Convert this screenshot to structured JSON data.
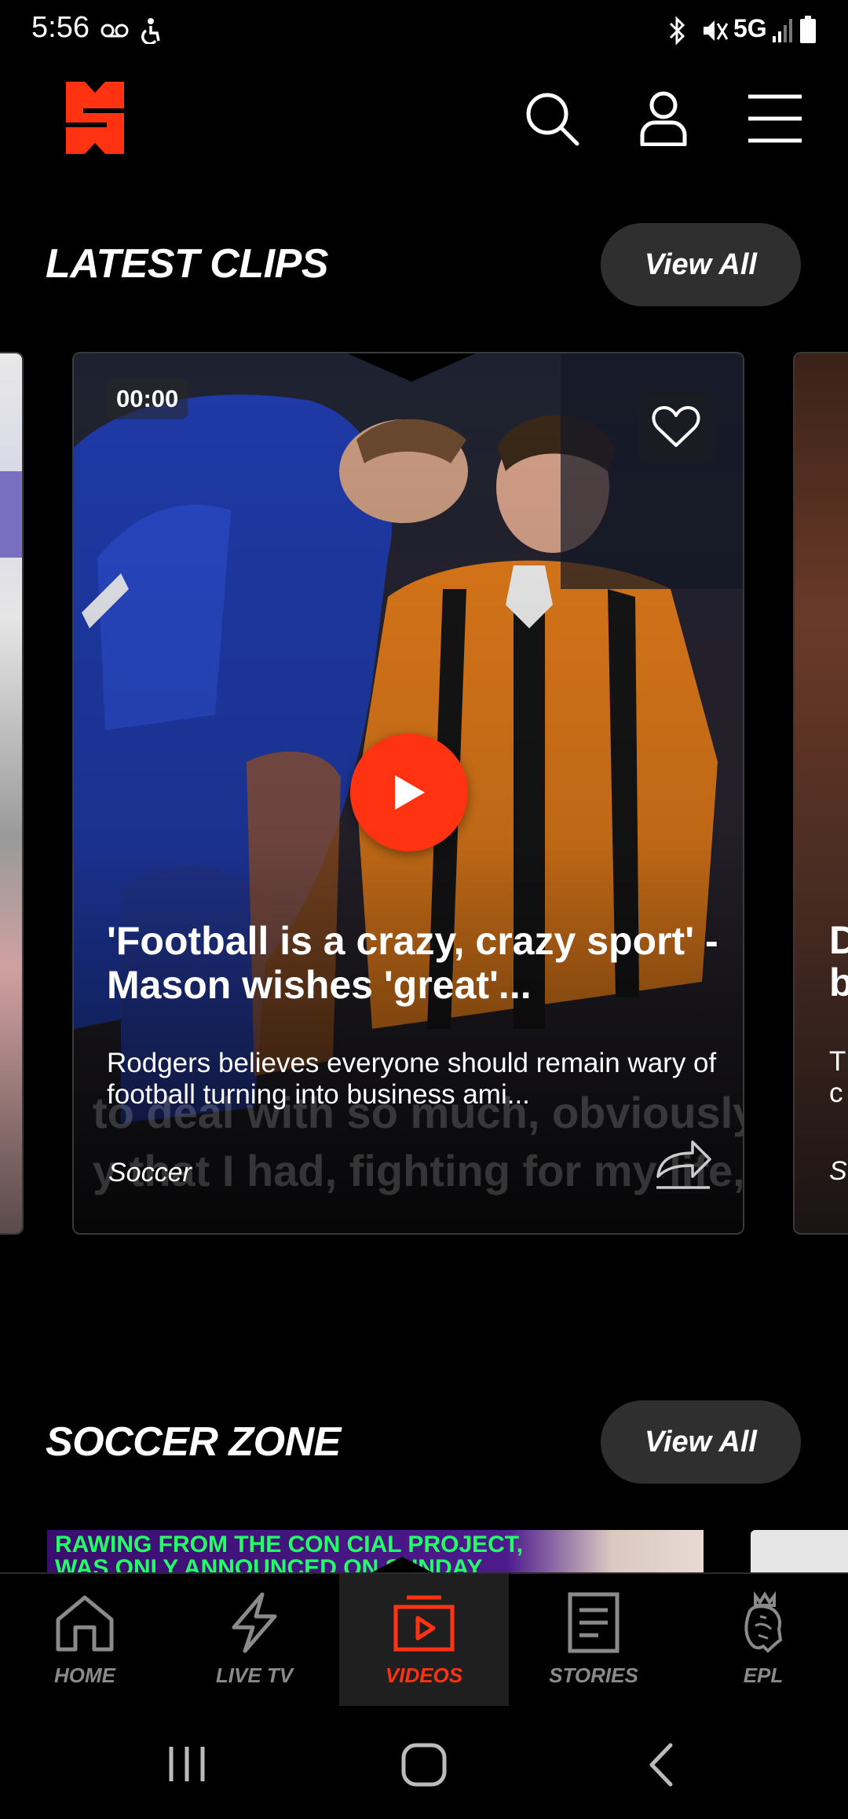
{
  "status_bar": {
    "time": "5:56",
    "network": "5G",
    "icons": [
      "voicemail-icon",
      "accessibility-icon",
      "bluetooth-icon",
      "mute-icon",
      "signal-icon",
      "battery-icon"
    ]
  },
  "header": {
    "logo": "supersport-logo",
    "icons": [
      "search-icon",
      "profile-icon",
      "menu-icon"
    ]
  },
  "latest_clips": {
    "title": "LATEST CLIPS",
    "view_all": "View All",
    "card": {
      "timestamp": "00:00",
      "title": "'Football is a crazy, crazy sport' - Mason wishes 'great'...",
      "description": "Rodgers believes everyone should remain wary of football turning into business ami...",
      "category": "Soccer",
      "subtitle_overlay": [
        "to deal with so much, obviously h",
        "y that I had, fighting for my life, I lo"
      ]
    },
    "next_card_peek": {
      "title_lines": [
        "D",
        "b"
      ],
      "desc_lines": [
        "T",
        "c"
      ],
      "category": "S"
    }
  },
  "soccer_zone": {
    "title": "SOCCER ZONE",
    "view_all": "View All",
    "preview_lines": [
      "RAWING FROM THE CON          CIAL PROJECT,",
      "WAS ONLY ANNOUNCED ON SUNDAY"
    ]
  },
  "bottom_nav": {
    "items": [
      {
        "label": "HOME",
        "icon": "home-icon",
        "active": false
      },
      {
        "label": "LIVE TV",
        "icon": "lightning-icon",
        "active": false
      },
      {
        "label": "VIDEOS",
        "icon": "video-play-icon",
        "active": true
      },
      {
        "label": "STORIES",
        "icon": "document-icon",
        "active": false
      },
      {
        "label": "EPL",
        "icon": "premier-league-lion-icon",
        "active": false
      }
    ]
  },
  "colors": {
    "accent": "#ff3311",
    "background": "#000000",
    "pill": "#2f2f2f",
    "inactive_nav": "#8a8a8a"
  }
}
